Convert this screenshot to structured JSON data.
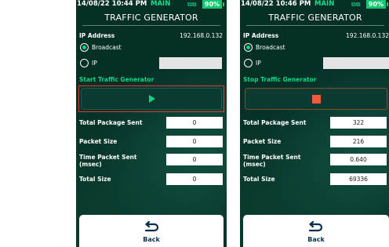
{
  "screens": [
    {
      "status": {
        "time": "14/08/22 10:44 PM",
        "mode": "MAIN",
        "battery": "90%"
      },
      "title": "TRAFFIC GENERATOR",
      "ip_label": "IP Address",
      "ip_value": "192.168.0.132",
      "radio_broadcast": "Broadcast",
      "radio_ip": "IP",
      "selected_radio": "Broadcast",
      "section": "Start Traffic Generator",
      "control_state": "play",
      "rows": [
        {
          "label": "Total Package Sent",
          "value": "0"
        },
        {
          "label": "Packet Size",
          "value": "0"
        },
        {
          "label": "Time Packet Sent (msec)",
          "value": "0"
        },
        {
          "label": "Total Size",
          "value": "0"
        }
      ],
      "back": "Back"
    },
    {
      "status": {
        "time": "14/08/22 10:46 PM",
        "mode": "MAIN",
        "battery": "90%"
      },
      "title": "TRAFFIC GENERATOR",
      "ip_label": "IP Address",
      "ip_value": "192.168.0.132",
      "radio_broadcast": "Broadcast",
      "radio_ip": "IP",
      "selected_radio": "Broadcast",
      "section": "Stop Traffic Generator",
      "control_state": "stop",
      "rows": [
        {
          "label": "Total Package Sent",
          "value": "322"
        },
        {
          "label": "Packet Size",
          "value": "216"
        },
        {
          "label": "Time Packet Sent (msec)",
          "value": "0.640"
        },
        {
          "label": "Total Size",
          "value": "69336"
        }
      ],
      "back": "Back"
    }
  ],
  "colors": {
    "background": "#062f26",
    "accent": "#13d483",
    "stop": "#f25a3a",
    "highlight": "#e53935"
  },
  "icons": [
    "play-icon",
    "stop-icon",
    "back-arrow-icon",
    "battery-icon",
    "device-icon"
  ]
}
